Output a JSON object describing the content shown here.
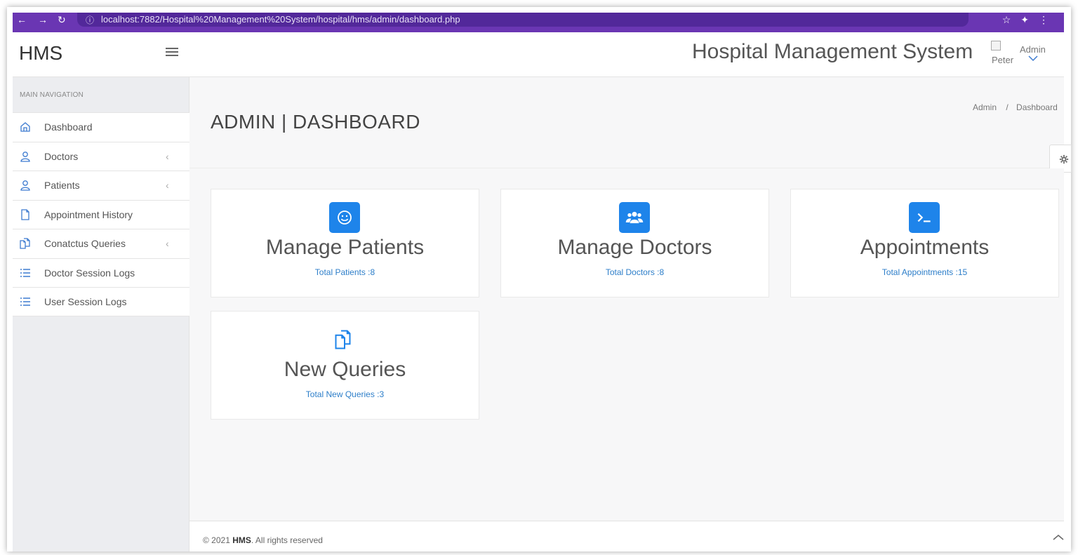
{
  "browser": {
    "url": "localhost:7882/Hospital%20Management%20System/hospital/hms/admin/dashboard.php"
  },
  "sidebar": {
    "brand": "HMS",
    "caption": "Main Navigation",
    "items": [
      {
        "label": "Dashboard",
        "icon": "home-icon",
        "has_children": false
      },
      {
        "label": "Doctors",
        "icon": "user-icon",
        "has_children": true
      },
      {
        "label": "Patients",
        "icon": "user-icon",
        "has_children": true
      },
      {
        "label": "Appointment History",
        "icon": "file-icon",
        "has_children": false
      },
      {
        "label": "Conatctus Queries",
        "icon": "files-icon",
        "has_children": true
      },
      {
        "label": "Doctor Session Logs",
        "icon": "list-icon",
        "has_children": false
      },
      {
        "label": "User Session Logs",
        "icon": "list-icon",
        "has_children": false
      }
    ]
  },
  "header": {
    "title": "Hospital Management System",
    "user_name": "Peter",
    "user_role": "Admin"
  },
  "page": {
    "title": "ADMIN | DASHBOARD",
    "breadcrumb": [
      "Admin",
      "Dashboard"
    ],
    "breadcrumb_sep": "/"
  },
  "cards": [
    {
      "title": "Manage Patients",
      "subtitle": "Total Patients :8",
      "icon": "smile-icon"
    },
    {
      "title": "Manage Doctors",
      "subtitle": "Total Doctors :8",
      "icon": "users-icon"
    },
    {
      "title": "Appointments",
      "subtitle": "Total Appointments :15",
      "icon": "terminal-icon"
    },
    {
      "title": "New Queries",
      "subtitle": "Total New Queries :3",
      "icon": "files-icon"
    }
  ],
  "footer": {
    "prefix": "© 2021",
    "brand": "HMS",
    "suffix": ". All rights reserved"
  },
  "colors": {
    "browser_bar": "#6a36b3",
    "accent_blue": "#1e84ea",
    "link_blue": "#2d7ec9"
  }
}
